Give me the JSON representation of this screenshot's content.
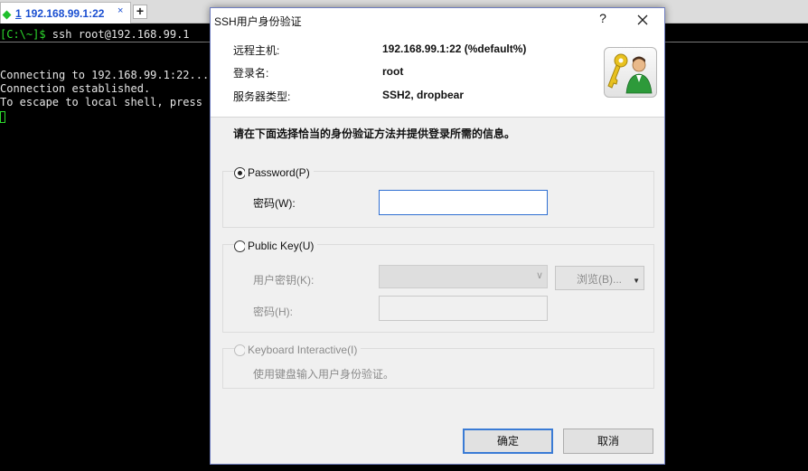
{
  "tab": {
    "number": "1",
    "title": "192.168.99.1:22",
    "close": "×",
    "add": "+"
  },
  "terminal": {
    "prompt": "[C:\\~]$",
    "command": " ssh root@192.168.99.1",
    "lines": [
      "Connecting to 192.168.99.1:22...",
      "Connection established.",
      "To escape to local shell, press 'C"
    ]
  },
  "dialog": {
    "title": "SSH用户身份验证",
    "help": "?",
    "info": {
      "remote_host_label": "远程主机:",
      "remote_host_value": "192.168.99.1:22 (%default%)",
      "login_label": "登录名:",
      "login_value": "root",
      "server_type_label": "服务器类型:",
      "server_type_value": "SSH2, dropbear"
    },
    "instruction": "请在下面选择恰当的身份验证方法并提供登录所需的信息。",
    "password_group": {
      "option": "Password(P)",
      "selected": true,
      "field_label": "密码(W):",
      "field_value": ""
    },
    "publickey_group": {
      "option": "Public Key(U)",
      "selected": false,
      "user_key_label": "用户密钥(K):",
      "user_key_value": "",
      "browse_label": "浏览(B)...",
      "passphrase_label": "密码(H):",
      "passphrase_value": ""
    },
    "keyboard_group": {
      "option": "Keyboard Interactive(I)",
      "selected": false,
      "description": "使用键盘输入用户身份验证。"
    },
    "ok_label": "确定",
    "cancel_label": "取消"
  },
  "colors": {
    "prompt": "#2ddc2d",
    "tab_text": "#1a4fd1",
    "tab_status": "#1fbf2c",
    "focus_border": "#2f6fd2"
  }
}
